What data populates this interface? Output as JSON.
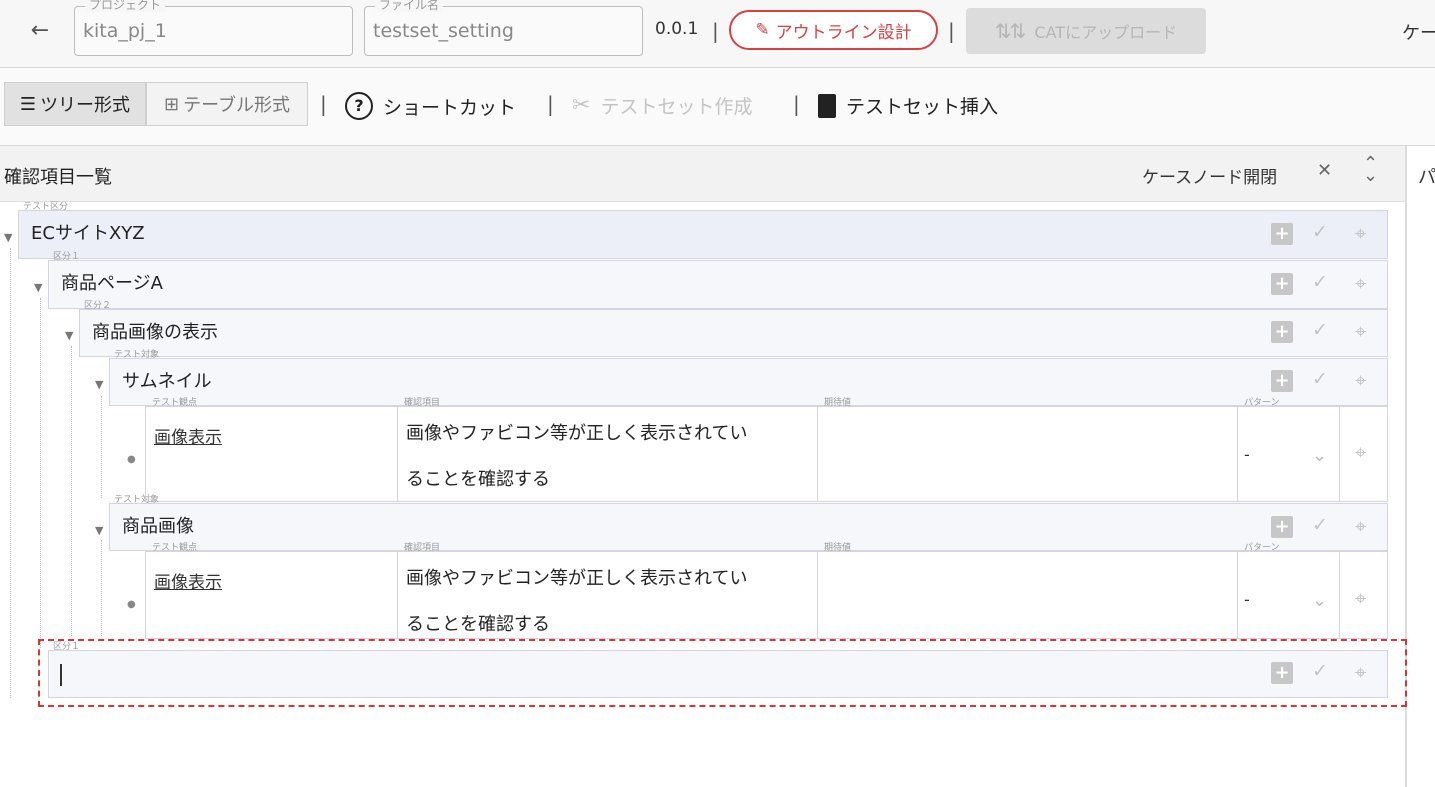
{
  "header": {
    "back_icon": "arrow-left-icon",
    "project": {
      "legend": "プロジェクト",
      "value": "kita_pj_1"
    },
    "file": {
      "legend": "ファイル名",
      "value": "testset_setting"
    },
    "version": "0.0.1",
    "separator": "|",
    "outline_button": "アウトライン設計",
    "cat_upload_button": "CATにアップロード",
    "cut_text": "ケー"
  },
  "toolbar": {
    "tree_view": "ツリー形式",
    "table_view": "テーブル形式",
    "shortcut": "ショートカット",
    "create_testset": "テストセット作成",
    "insert_testset": "テストセット挿入"
  },
  "panel": {
    "title": "確認項目一覧",
    "case_node_toggle": "ケースノード開閉",
    "right_cut": "パ"
  },
  "tree": {
    "root": {
      "label": "テスト区分",
      "title": "ECサイトXYZ"
    },
    "level1": {
      "label": "区分１",
      "title": "商品ページA"
    },
    "level2": {
      "label": "区分２",
      "title": "商品画像の表示"
    },
    "target1": {
      "label": "テスト対象",
      "title": "サムネイル"
    },
    "target2": {
      "label": "テスト対象",
      "title": "商品画像"
    },
    "row_labels": {
      "viewpoint": "テスト観点",
      "check": "確認項目",
      "expected": "期待値",
      "pattern": "パターン"
    },
    "row1": {
      "viewpoint": "画像表示",
      "check_line1": "画像やファビコン等が正しく表示されてい",
      "check_line2": "ることを確認する",
      "expected": "",
      "pattern": "-"
    },
    "row2": {
      "viewpoint": "画像表示",
      "check_line1": "画像やファビコン等が正しく表示されてい",
      "check_line2": "ることを確認する",
      "expected": "",
      "pattern": "-"
    },
    "new_node": {
      "label": "区分１",
      "title": ""
    }
  },
  "colors": {
    "accent_red": "#d94040",
    "highlight": "#e53030"
  }
}
